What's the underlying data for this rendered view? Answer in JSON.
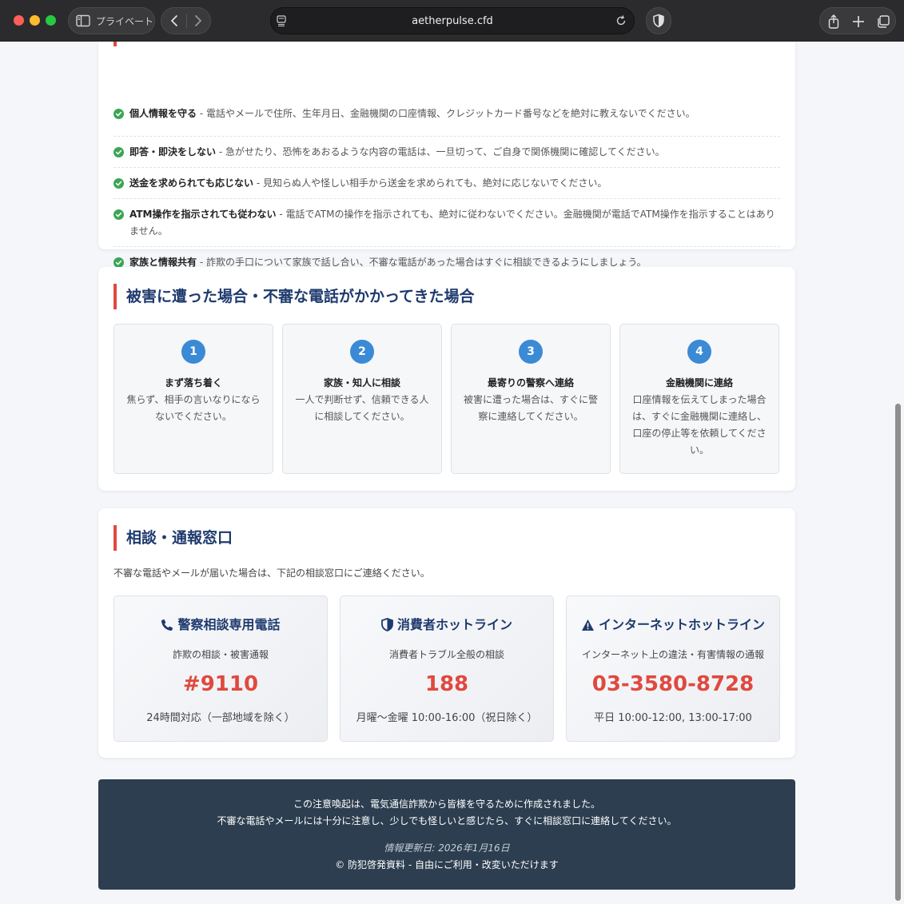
{
  "browser": {
    "private_label": "プライベート",
    "url": "aetherpulse.cfd"
  },
  "prevention": {
    "items": [
      {
        "title": "個人情報を守る",
        "text": " - 電話やメールで住所、生年月日、金融機関の口座情報、クレジットカード番号などを絶対に教えないでください。"
      },
      {
        "title": "即答・即決をしない",
        "text": " - 急がせたり、恐怖をあおるような内容の電話は、一旦切って、ご自身で関係機関に確認してください。"
      },
      {
        "title": "送金を求められても応じない",
        "text": " - 見知らぬ人や怪しい相手から送金を求められても、絶対に応じないでください。"
      },
      {
        "title": "ATM操作を指示されても従わない",
        "text": " - 電話でATMの操作を指示されても、絶対に従わないでください。金融機関が電話でATM操作を指示することはありません。"
      },
      {
        "title": "家族と情報共有",
        "text": " - 詐欺の手口について家族で話し合い、不審な電話があった場合はすぐに相談できるようにしましょう。"
      }
    ]
  },
  "damage": {
    "title": "被害に遭った場合・不審な電話がかかってきた場合",
    "steps": [
      {
        "num": "1",
        "title": "まず落ち着く",
        "desc": "焦らず、相手の言いなりにならないでください。"
      },
      {
        "num": "2",
        "title": "家族・知人に相談",
        "desc": "一人で判断せず、信頼できる人に相談してください。"
      },
      {
        "num": "3",
        "title": "最寄りの警察へ連絡",
        "desc": "被害に遭った場合は、すぐに警察に連絡してください。"
      },
      {
        "num": "4",
        "title": "金融機関に連絡",
        "desc": "口座情報を伝えてしまった場合は、すぐに金融機関に連絡し、口座の停止等を依頼してください。"
      }
    ]
  },
  "contact": {
    "title": "相談・通報窓口",
    "intro": "不審な電話やメールが届いた場合は、下記の相談窓口にご連絡ください。",
    "cards": [
      {
        "icon": "phone-icon",
        "title": "警察相談専用電話",
        "sub": "詐欺の相談・被害通報",
        "number": "#9110",
        "hours": "24時間対応（一部地域を除く）"
      },
      {
        "icon": "shield-icon",
        "title": "消費者ホットライン",
        "sub": "消費者トラブル全般の相談",
        "number": "188",
        "hours": "月曜〜金曜 10:00-16:00（祝日除く）"
      },
      {
        "icon": "warning-icon",
        "title": "インターネットホットライン",
        "sub": "インターネット上の違法・有害情報の通報",
        "number": "03-3580-8728",
        "hours": "平日 10:00-12:00, 13:00-17:00"
      }
    ]
  },
  "footer": {
    "line1": "この注意喚起は、電気通信詐欺から皆様を守るために作成されました。",
    "line2": "不審な電話やメールには十分に注意し、少しでも怪しいと感じたら、すぐに相談窓口に連絡してください。",
    "updated": "情報更新日: 2026年1月16日",
    "copyright": "© 防犯啓発資料 - 自由にご利用・改変いただけます"
  },
  "colors": {
    "accent_red": "#e0493e",
    "heading_navy": "#1e3a6e",
    "step_blue": "#3a8ad6",
    "check_green": "#3aa655",
    "footer_bg": "#2c3e50"
  }
}
